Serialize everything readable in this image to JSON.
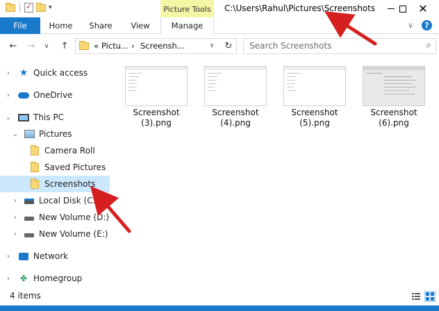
{
  "titlebar": {
    "contextual_tab": "Picture Tools",
    "window_title": "C:\\Users\\Rahul\\Pictures\\Screenshots"
  },
  "ribbon": {
    "tabs": [
      "File",
      "Home",
      "Share",
      "View",
      "Manage"
    ]
  },
  "address": {
    "overflow": "«",
    "crumbs": [
      "Pictu...",
      "Screensh..."
    ],
    "search_placeholder": "Search Screenshots"
  },
  "navpane": {
    "items": [
      {
        "label": "Quick access",
        "icon": "star-icon"
      },
      {
        "label": "OneDrive",
        "icon": "cloud-icon"
      },
      {
        "label": "This PC",
        "icon": "computer-icon"
      },
      {
        "label": "Pictures",
        "icon": "pictures-icon"
      },
      {
        "label": "Camera Roll",
        "icon": "folder-icon"
      },
      {
        "label": "Saved Pictures",
        "icon": "folder-icon"
      },
      {
        "label": "Screenshots",
        "icon": "folder-icon"
      },
      {
        "label": "Local Disk (C:)",
        "icon": "drive-icon"
      },
      {
        "label": "New Volume (D:)",
        "icon": "drive-icon"
      },
      {
        "label": "New Volume (E:)",
        "icon": "drive-icon"
      },
      {
        "label": "Network",
        "icon": "network-icon"
      },
      {
        "label": "Homegroup",
        "icon": "homegroup-icon"
      }
    ]
  },
  "files": [
    {
      "line1": "Screenshot",
      "line2": "(3).png"
    },
    {
      "line1": "Screenshot",
      "line2": "(4).png"
    },
    {
      "line1": "Screenshot",
      "line2": "(5).png"
    },
    {
      "line1": "Screenshot",
      "line2": "(6).png"
    }
  ],
  "status": {
    "item_count": "4 items"
  },
  "colors": {
    "accent": "#1979ca",
    "contextual": "#f5f5a6",
    "selected": "#cce8ff",
    "arrow": "#d62020"
  }
}
